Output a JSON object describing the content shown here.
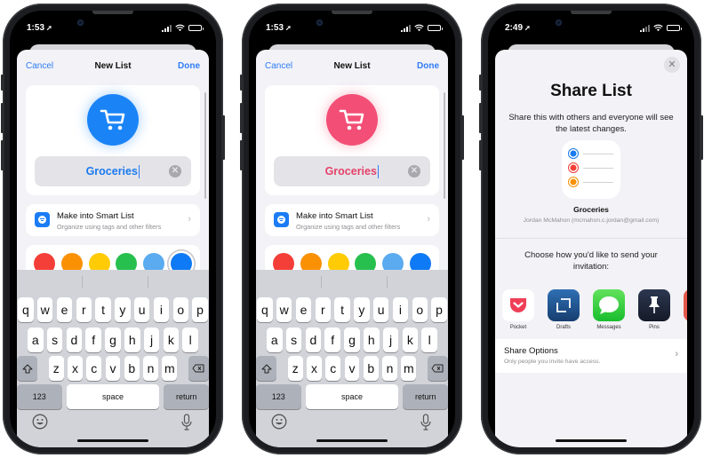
{
  "phones": [
    {
      "status": {
        "time": "1:53"
      },
      "nav": {
        "cancel": "Cancel",
        "title": "New List",
        "done": "Done"
      },
      "list_icon": {
        "name": "shopping-cart",
        "color": "#1a84f7"
      },
      "name_field": {
        "value": "Groceries",
        "color": "#1a7af0"
      },
      "smart_list": {
        "title": "Make into Smart List",
        "subtitle": "Organize using tags and other filters"
      },
      "colors": [
        "#f43f38",
        "#fa9105",
        "#fecb05",
        "#27c04e",
        "#5aabf0",
        "#0f7af5"
      ],
      "selected_color_index": 5
    },
    {
      "status": {
        "time": "1:53"
      },
      "nav": {
        "cancel": "Cancel",
        "title": "New List",
        "done": "Done"
      },
      "list_icon": {
        "name": "shopping-cart",
        "color": "#f24e76"
      },
      "name_field": {
        "value": "Groceries",
        "color": "#e5416a"
      },
      "smart_list": {
        "title": "Make into Smart List",
        "subtitle": "Organize using tags and other filters"
      },
      "colors": [
        "#f43f38",
        "#fa9105",
        "#fecb05",
        "#27c04e",
        "#5aabf0",
        "#0f7af5"
      ],
      "selected_color_index": null
    }
  ],
  "keyboard": {
    "row1": [
      "q",
      "w",
      "e",
      "r",
      "t",
      "y",
      "u",
      "i",
      "o",
      "p"
    ],
    "row2": [
      "a",
      "s",
      "d",
      "f",
      "g",
      "h",
      "j",
      "k",
      "l"
    ],
    "row3": [
      "z",
      "x",
      "c",
      "v",
      "b",
      "n",
      "m"
    ],
    "numbers": "123",
    "space": "space",
    "return": "return"
  },
  "share": {
    "status": {
      "time": "2:49"
    },
    "title": "Share List",
    "description": "Share this with others and everyone will see the latest changes.",
    "list_name": "Groceries",
    "owner": "Jordan McMahon (mcmahon.c.jordan@gmail.com)",
    "list_icon_dots": [
      "#1a7af0",
      "#f43f38",
      "#fa9105"
    ],
    "prompt": "Choose how you'd like to send your invitation:",
    "apps": [
      {
        "label": "Pocket",
        "icon": "pocket-icon"
      },
      {
        "label": "Drafts",
        "icon": "drafts-icon"
      },
      {
        "label": "Messages",
        "icon": "messages-icon"
      },
      {
        "label": "Pins",
        "icon": "pins-icon"
      }
    ],
    "options": {
      "title": "Share Options",
      "subtitle": "Only people you invite have access."
    }
  }
}
